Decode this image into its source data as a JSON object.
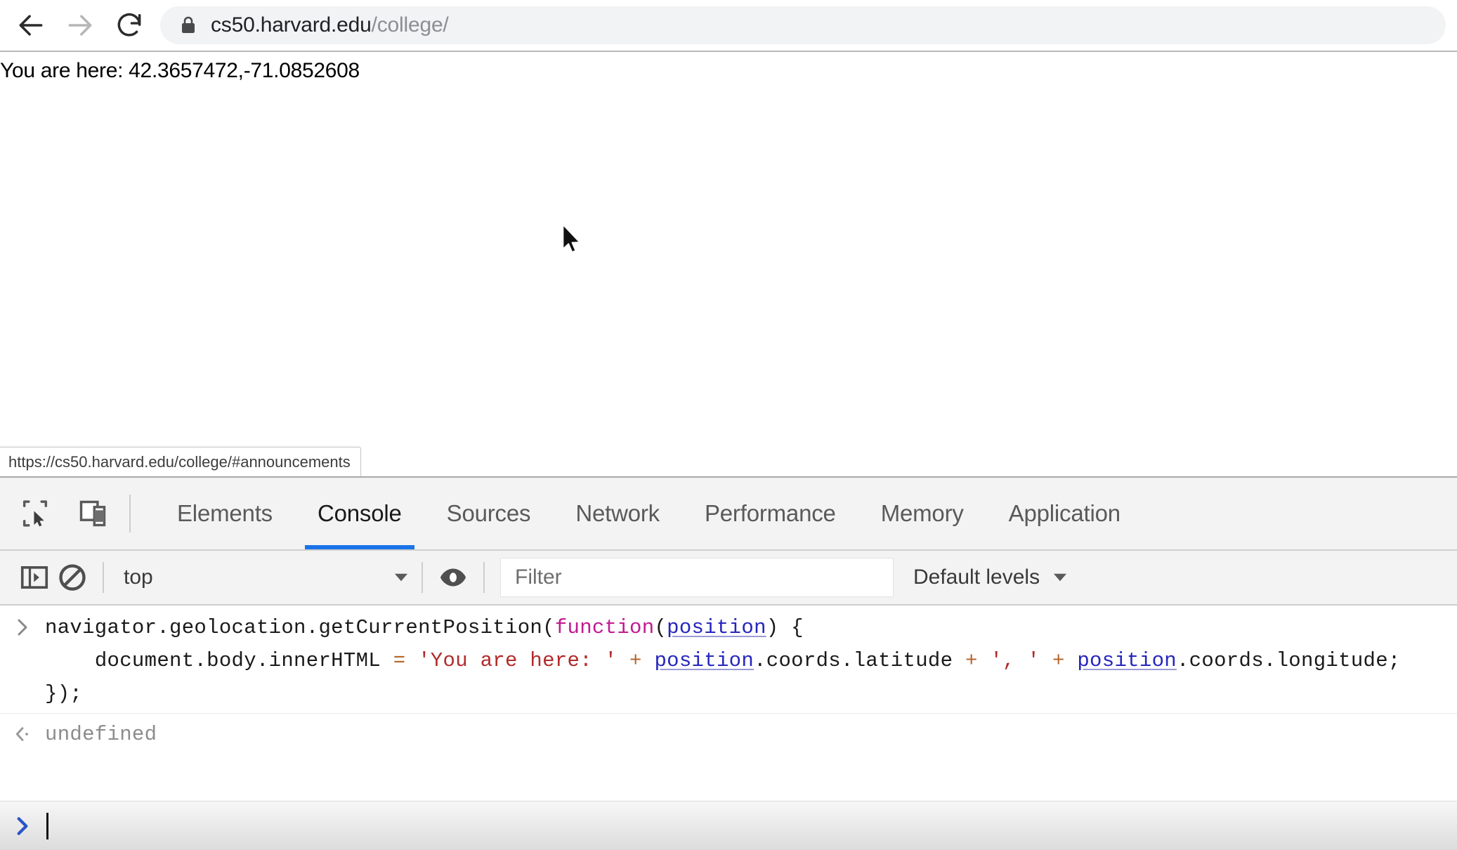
{
  "browser": {
    "nav": {
      "back_label": "Back",
      "forward_label": "Forward",
      "reload_label": "Reload",
      "back_icon": "arrow-left-icon",
      "forward_icon": "arrow-right-icon",
      "reload_icon": "reload-icon"
    },
    "omnibox": {
      "lock_icon": "lock-icon",
      "host": "cs50.harvard.edu",
      "path": "/college/",
      "full_url": "cs50.harvard.edu/college/"
    }
  },
  "page": {
    "body_text": "You are here: 42.3657472,-71.0852608",
    "latitude": "42.3657472",
    "longitude": "-71.0852608",
    "cursor_icon": "mouse-pointer-icon",
    "status_bubble": "https://cs50.harvard.edu/college/#announcements"
  },
  "devtools": {
    "toolbar_icons": {
      "inspect": "inspect-element-icon",
      "device": "device-toolbar-icon"
    },
    "tabs": [
      {
        "label": "Elements",
        "active": false
      },
      {
        "label": "Console",
        "active": true
      },
      {
        "label": "Sources",
        "active": false
      },
      {
        "label": "Network",
        "active": false
      },
      {
        "label": "Performance",
        "active": false
      },
      {
        "label": "Memory",
        "active": false
      },
      {
        "label": "Application",
        "active": false
      }
    ],
    "active_tab": "Console",
    "accent_color": "#1a73e8",
    "console_toolbar": {
      "sidebar_icon": "console-sidebar-toggle-icon",
      "clear_icon": "clear-console-icon",
      "context_value": "top",
      "context_caret_icon": "chevron-down-icon",
      "eye_icon": "live-expression-eye-icon",
      "filter_value": "",
      "filter_placeholder": "Filter",
      "levels_label": "Default levels",
      "levels_caret_icon": "chevron-down-icon"
    },
    "console": {
      "input_prompt_icon": "chevron-right-icon",
      "result_prompt_icon": "return-arrow-icon",
      "input_lines": [
        {
          "tokens": [
            {
              "t": "navigator",
              "c": "plain"
            },
            {
              "t": ".",
              "c": "plain"
            },
            {
              "t": "geolocation",
              "c": "plain"
            },
            {
              "t": ".",
              "c": "plain"
            },
            {
              "t": "getCurrentPosition",
              "c": "plain"
            },
            {
              "t": "(",
              "c": "plain"
            },
            {
              "t": "function",
              "c": "kw"
            },
            {
              "t": "(",
              "c": "plain"
            },
            {
              "t": "position",
              "c": "var"
            },
            {
              "t": ") {",
              "c": "plain"
            }
          ]
        },
        {
          "tokens": [
            {
              "t": "    document",
              "c": "plain"
            },
            {
              "t": ".body.innerHTML ",
              "c": "plain"
            },
            {
              "t": "=",
              "c": "op"
            },
            {
              "t": " ",
              "c": "plain"
            },
            {
              "t": "'You are here: '",
              "c": "string"
            },
            {
              "t": " ",
              "c": "plain"
            },
            {
              "t": "+",
              "c": "op"
            },
            {
              "t": " ",
              "c": "plain"
            },
            {
              "t": "position",
              "c": "var"
            },
            {
              "t": ".coords.latitude ",
              "c": "plain"
            },
            {
              "t": "+",
              "c": "op"
            },
            {
              "t": " ",
              "c": "plain"
            },
            {
              "t": "', '",
              "c": "string"
            },
            {
              "t": " ",
              "c": "plain"
            },
            {
              "t": "+",
              "c": "op"
            },
            {
              "t": " ",
              "c": "plain"
            },
            {
              "t": "position",
              "c": "var"
            },
            {
              "t": ".coords.longitude;",
              "c": "plain"
            }
          ]
        },
        {
          "tokens": [
            {
              "t": "});",
              "c": "plain"
            }
          ]
        }
      ],
      "raw_input": "navigator.geolocation.getCurrentPosition(function(position) {\n    document.body.innerHTML = 'You are here: ' + position.coords.latitude + ', ' + position.coords.longitude;\n});",
      "result_value": "undefined",
      "prompt_value": ""
    }
  }
}
